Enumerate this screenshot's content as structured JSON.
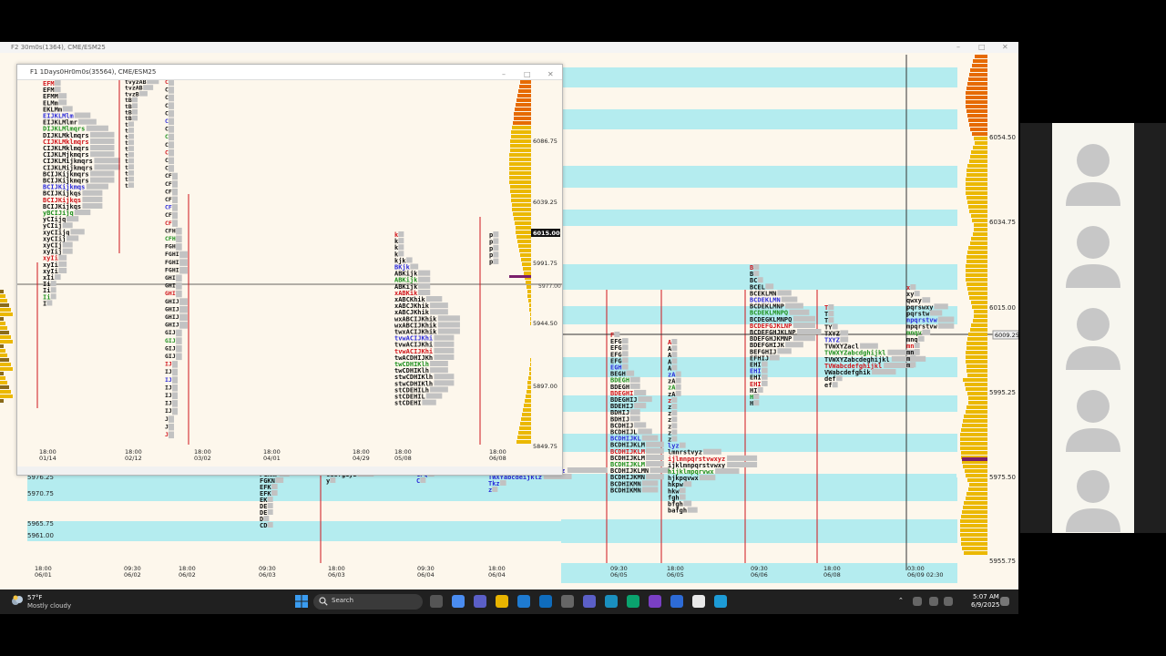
{
  "main_window": {
    "title": "F2 30m0s(1364), CME/ESM25",
    "price_labels": [
      "6054.50",
      "6034.75",
      "6015.00",
      "5995.25",
      "5975.50",
      "5955.75"
    ],
    "current_price_tag": "6009.25",
    "left_price_labels": [
      "5976.25",
      "5970.75",
      "5965.75",
      "5961.00"
    ],
    "time_axis": [
      {
        "t": "18:00",
        "d": "06/01"
      },
      {
        "t": "09:30",
        "d": "06/02"
      },
      {
        "t": "18:00",
        "d": "06/02"
      },
      {
        "t": "09:30",
        "d": "06/03"
      },
      {
        "t": "18:00",
        "d": "06/03"
      },
      {
        "t": "09:30",
        "d": "06/04"
      },
      {
        "t": "18:00",
        "d": "06/04"
      },
      {
        "t": "09:30",
        "d": "06/05"
      },
      {
        "t": "18:00",
        "d": "06/05"
      },
      {
        "t": "09:30",
        "d": "06/06"
      },
      {
        "t": "18:00",
        "d": "06/08"
      },
      {
        "t": "03:00",
        "d": "06/09 02:30"
      }
    ],
    "tpo_columns": [
      {
        "rows": [
          "FGKNPQ",
          "FGKNP",
          "FGKN",
          "EFK",
          "EFK",
          "EK",
          "DE",
          "DE",
          "D",
          "CD"
        ]
      },
      {
        "rows": [
          "bcdefghijlyz",
          "cdefgiyz",
          "y"
        ]
      },
      {
        "rows": [
          "CGPQR",
          "CPQ",
          "C"
        ]
      },
      {
        "rows": [
          "TVWXYZabcdefghiklmwz",
          "TWXYabcdeijklz",
          "Tkz",
          "z"
        ]
      },
      {
        "rows": [
          "F",
          "EFG",
          "EFG",
          "EFG",
          "EFG",
          "EGH",
          "BEGH",
          "BDEGH",
          "BDEGH",
          "BDEGHI",
          "BDEGHIJ",
          "BDEHIJ",
          "BDHIJ",
          "BDHIJ",
          "BCDHIJ",
          "BCDHIJL",
          "BCDHIJKL",
          "BCDHIJKLM",
          "BCDHIJKLM",
          "BCDHIJKLM",
          "BCDHIJKLM",
          "BCDHIJKLMN",
          "BCDHIJKMN",
          "BCDHIKMN",
          "BCDHIKMN"
        ]
      },
      {
        "rows": [
          "A",
          "A",
          "A",
          "A",
          "A",
          "zA",
          "zA",
          "zA",
          "zA",
          "z",
          "z",
          "z",
          "z",
          "z",
          "z",
          "z",
          "lyz",
          "lmnrstvyz",
          "ijlmnpqrstvwxyz",
          "ijklmnpqrstvwxy",
          "hijklmpqrvwx",
          "hjkpqvwx",
          "hkpw",
          "hkw",
          "fgh",
          "bfgh",
          "bafgh"
        ]
      },
      {
        "rows": [
          "B",
          "B",
          "BC",
          "BCEL",
          "BCEKLMN",
          "BCDEKLMN",
          "BCDEKLMNP",
          "BCDEKLMNPQ",
          "BCDEGKLMNPQ",
          "BCDEFGJKLNP",
          "BCDEFGHJKLNP",
          "BDEFGHJKMNP",
          "BDEFGHIJK",
          "BEFGHIJ",
          "EFHIJ",
          "EHI",
          "EHI",
          "EHI",
          "EHI",
          "HI",
          "H",
          "H"
        ]
      },
      {
        "rows": [
          "T",
          "T",
          "T",
          "TY",
          "TXYZ",
          "TXYZ",
          "TVWXYZacl",
          "TVWXYZabcdghijkl",
          "TVWXYZabcdeghijkl",
          "TVWabcdefghijkl",
          "VWabcdefghik",
          "def",
          "ef"
        ]
      },
      {
        "rows": [
          "x",
          "xy",
          "qwxy",
          "pqrswxy",
          "pqrstw",
          "npqrstvw",
          "mpqrstvw",
          "mnqv",
          "mnq",
          "mn",
          "mn",
          "m",
          "m"
        ]
      }
    ]
  },
  "inner_window": {
    "title": "F1 1Days0Hr0m0s(35564), CME/ESM25",
    "price_labels": [
      "6086.75",
      "6039.25",
      "5991.75",
      "5944.50",
      "5897.00",
      "5849.75"
    ],
    "current_price_tag": "6015.00",
    "secondary_tag": "5977.00",
    "time_axis": [
      {
        "t": "18:00",
        "d": "01/14"
      },
      {
        "t": "18:00",
        "d": "02/12"
      },
      {
        "t": "18:00",
        "d": "03/02"
      },
      {
        "t": "18:00",
        "d": "04/01"
      },
      {
        "t": "18:00",
        "d": "04/29"
      },
      {
        "t": "18:00",
        "d": "05/08"
      },
      {
        "t": "18:00",
        "d": "06/08"
      }
    ],
    "tpo_columns": [
      {
        "rows": [
          "EFM",
          "EFM",
          "EFMM",
          "ELMm",
          "EKLMm",
          "EIJKLMlm",
          "EIJKLMlmr",
          "DIJKLMlmqrs",
          "DIJKLMklmqrs",
          "CIJKLMklmqrs",
          "CIJKLMklmqrs",
          "CIJKLMjkmqrs",
          "CIJKLMijkmqrs",
          "CIJKLMijkmqrs",
          "BCIJKijkmqrs",
          "BCIJKijkmqrs",
          "BCIJKijkmqs",
          "BCIJKijkqs",
          "BCIJKijkqs",
          "BCIJKijkqs",
          "yBCIJijq",
          "yCIijq",
          "yCIij",
          "xyCIijq",
          "xyCIij",
          "xyCIj",
          "xyIij",
          "xyIi",
          "xyIi",
          "xyIi",
          "xIi",
          "Ii",
          "Ii",
          "Ii",
          "I"
        ]
      },
      {
        "rows": [
          "tvyzAB",
          "tvzAB",
          "tvzB",
          "tB",
          "tB",
          "tB",
          "tB",
          "t",
          "t",
          "t",
          "t",
          "t",
          "t",
          "t",
          "t",
          "t",
          "t",
          "t"
        ]
      },
      {
        "rows": [
          "C",
          "C",
          "C",
          "C",
          "C",
          "C",
          "C",
          "C",
          "C",
          "C",
          "C",
          "C",
          "CF",
          "CF",
          "CF",
          "CF",
          "CF",
          "CF",
          "CF",
          "CFH",
          "CFH",
          "FGH",
          "FGHI",
          "FGHI",
          "FGHI",
          "GHI",
          "GHI",
          "GHI",
          "GHIJ",
          "GHIJ",
          "GHIJ",
          "GHIJ",
          "GIJ",
          "GIJ",
          "GIJ",
          "GIJ",
          "IJ",
          "IJ",
          "IJ",
          "IJ",
          "IJ",
          "IJ",
          "IJ",
          "J",
          "J",
          "J"
        ]
      },
      {
        "rows": [
          "k",
          "k",
          "k",
          "k",
          "kjk",
          "BKjk",
          "ABKijk",
          "ABKijk",
          "ABKijk",
          "xABKik",
          "xABCKhik",
          "xABCJKhik",
          "xABCJKhik",
          "wxABCIJKhik",
          "wxABCIJKhik",
          "twxACIJKhik",
          "tvwACIJKhi",
          "tvwACIJKhi",
          "tvwACIJKhi",
          "twACDHIJKh",
          "twCDHIKlh",
          "twCDHIKlh",
          "stwCDHIKlh",
          "stwCDHIKlh",
          "stCDEHILh",
          "stCDEHIL",
          "stCDEHI"
        ]
      },
      {
        "rows": [
          "p",
          "p",
          "p",
          "p",
          "p"
        ]
      }
    ]
  },
  "taskbar": {
    "weather_temp": "57°F",
    "weather_desc": "Mostly cloudy",
    "search_placeholder": "Search",
    "time": "5:07 AM",
    "date": "6/9/2025"
  },
  "colors": {
    "background": "#fdf7ec",
    "band": "#b4ecef",
    "tpo_text": "#111111",
    "tpo_red": "#d0151b",
    "tpo_blue": "#2a2ad8",
    "tpo_green": "#1c8f1c",
    "tpo_pink": "#e03ca8",
    "volume_yellow": "#ebb800",
    "volume_orange": "#e66a00",
    "poc": "#7a1f6c",
    "gray_bar": "#c2c2c2",
    "taskbar": "#202020"
  }
}
